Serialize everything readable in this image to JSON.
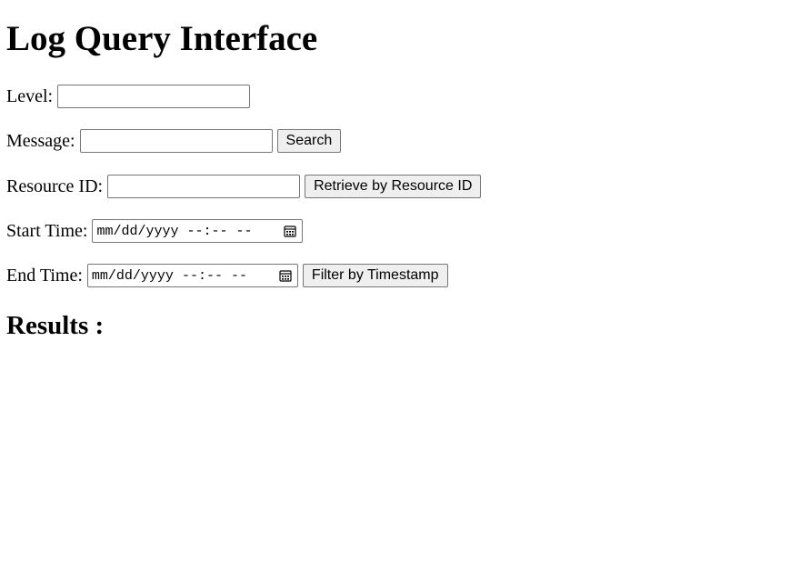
{
  "page": {
    "title": "Log Query Interface",
    "results_heading": "Results :"
  },
  "form": {
    "level": {
      "label": "Level:",
      "value": "",
      "placeholder": ""
    },
    "message": {
      "label": "Message:",
      "value": "",
      "placeholder": "",
      "button_label": "Search"
    },
    "resource_id": {
      "label": "Resource ID:",
      "value": "",
      "placeholder": "",
      "button_label": "Retrieve by Resource ID"
    },
    "start_time": {
      "label": "Start Time:",
      "display": "mm/dd/yyyy --:-- --",
      "icon": "calendar-icon"
    },
    "end_time": {
      "label": "End Time:",
      "display": "mm/dd/yyyy --:-- --",
      "icon": "calendar-icon",
      "button_label": "Filter by Timestamp"
    }
  },
  "colors": {
    "input_border": "#767676",
    "button_bg": "#efefef",
    "text": "#000000",
    "background": "#ffffff"
  }
}
